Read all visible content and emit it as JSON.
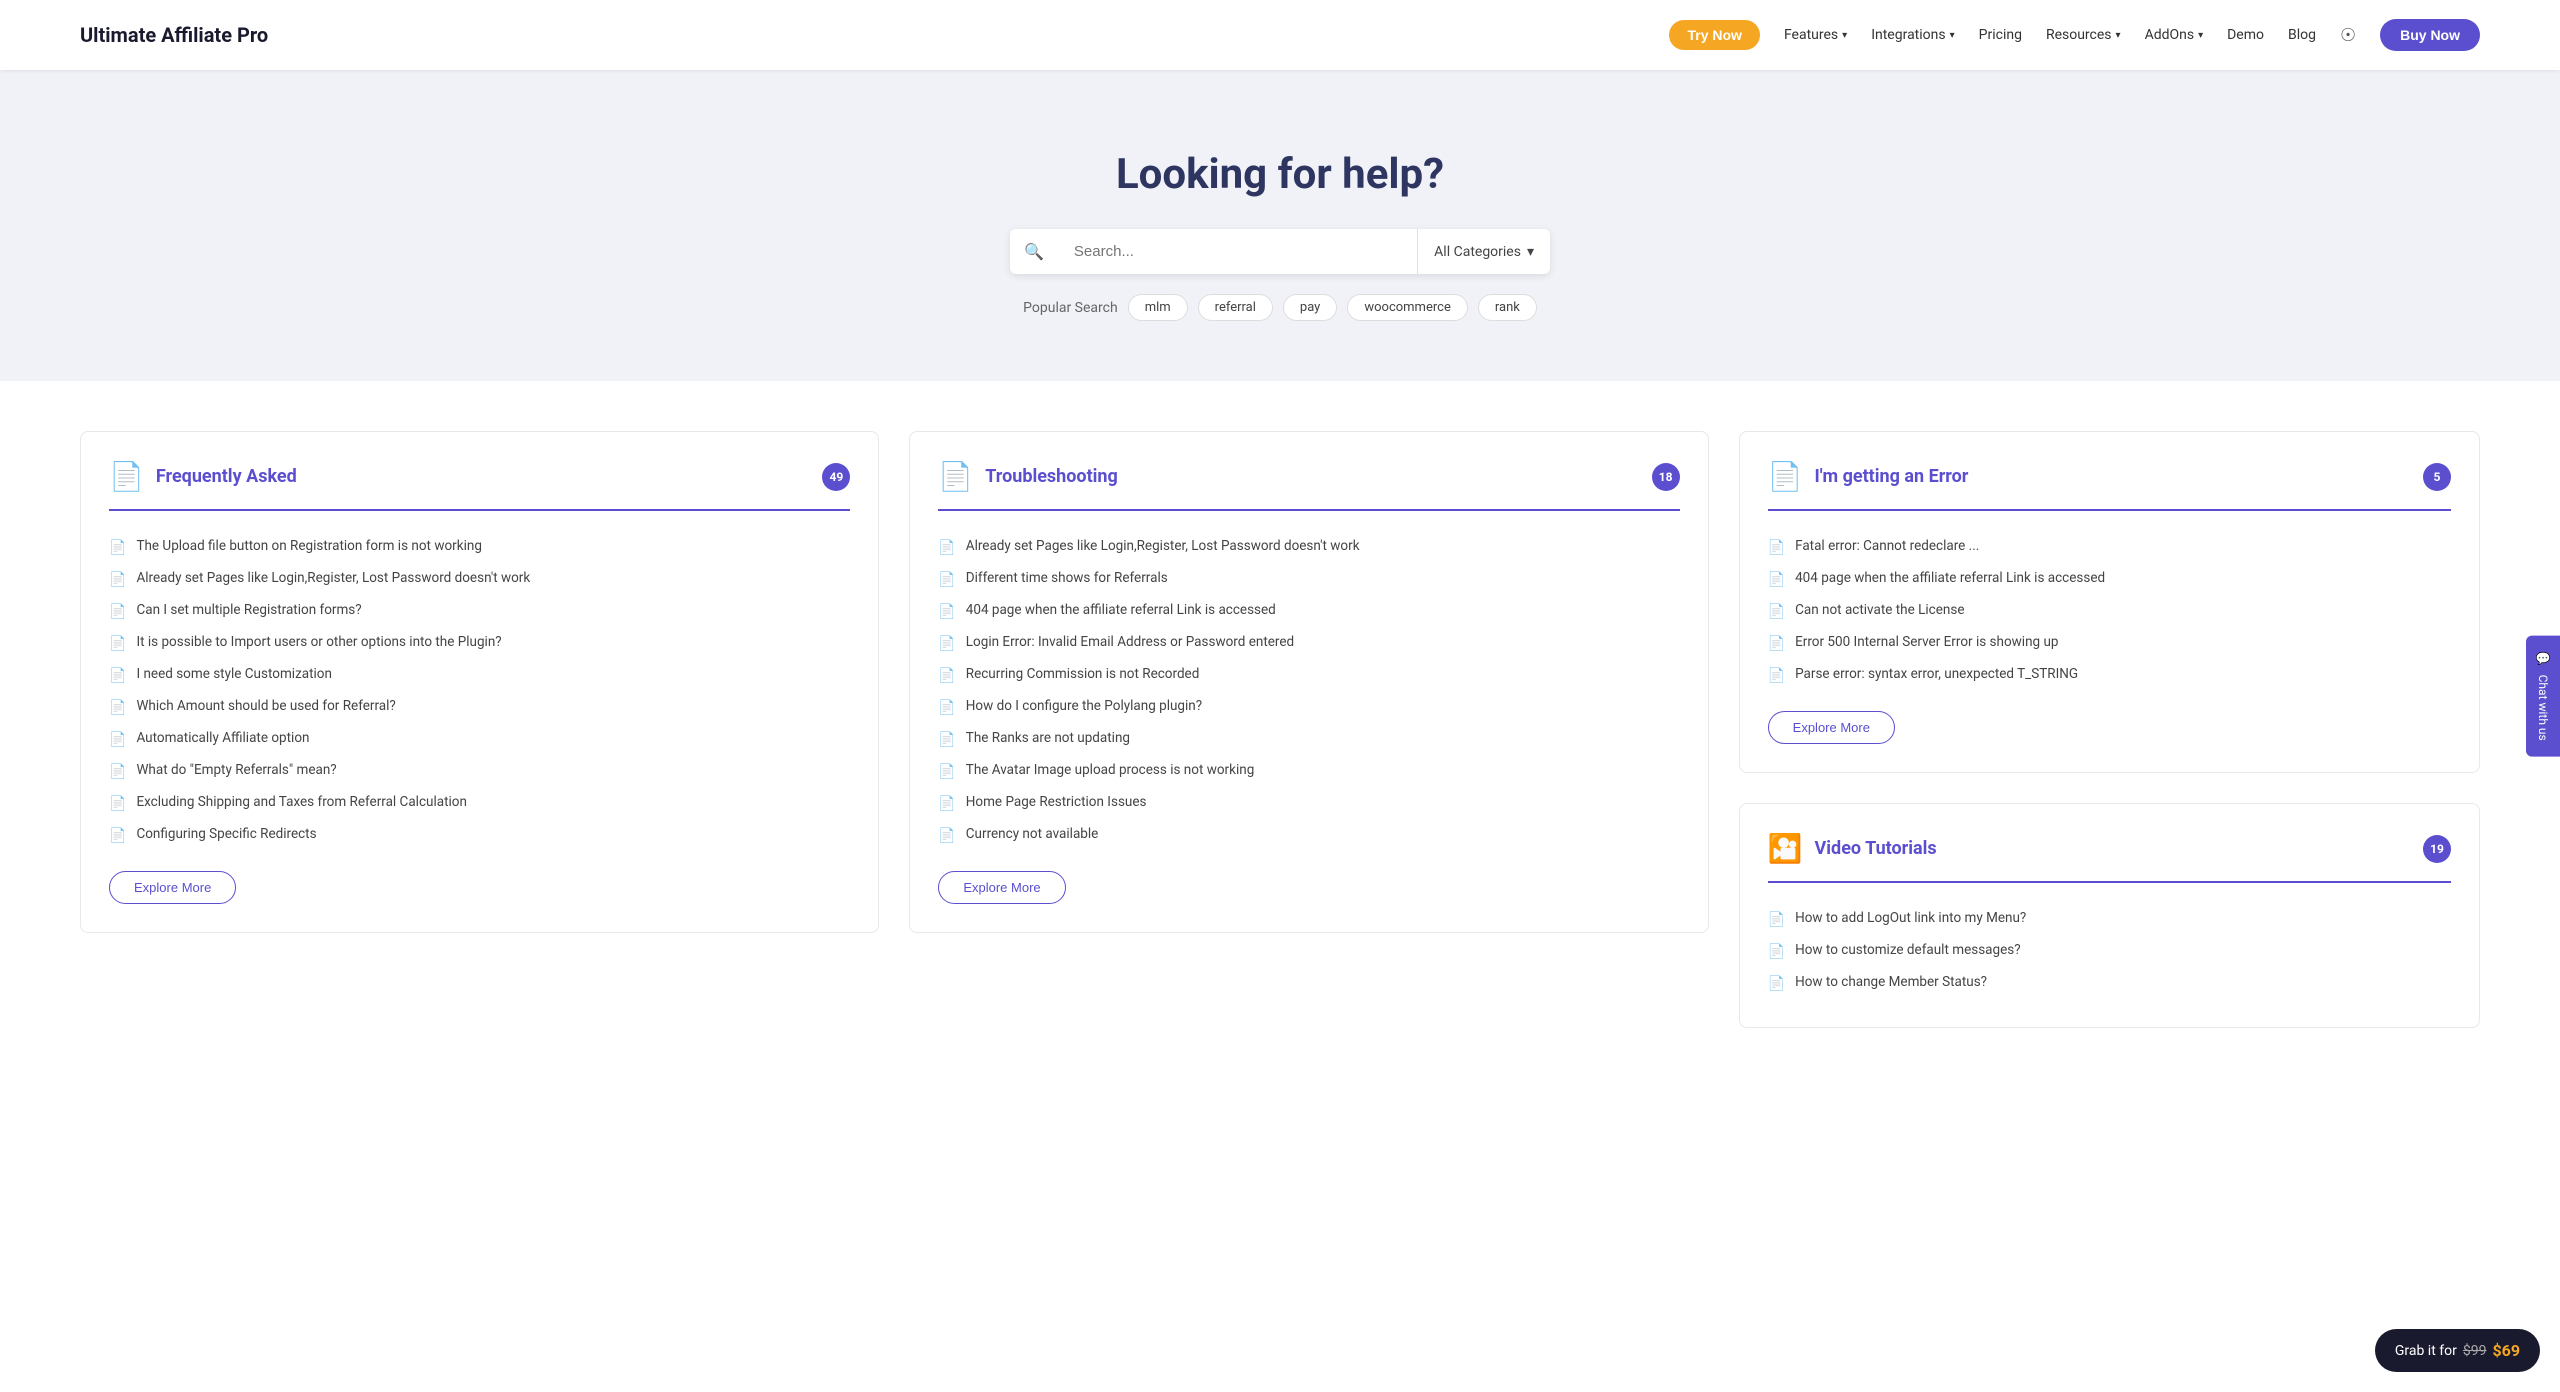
{
  "brand": "Ultimate Affiliate Pro",
  "nav": {
    "try_now": "Try Now",
    "links": [
      {
        "label": "Features",
        "has_dropdown": true
      },
      {
        "label": "Integrations",
        "has_dropdown": true
      },
      {
        "label": "Pricing",
        "has_dropdown": false
      },
      {
        "label": "Resources",
        "has_dropdown": true
      },
      {
        "label": "AddOns",
        "has_dropdown": true
      },
      {
        "label": "Demo",
        "has_dropdown": false
      },
      {
        "label": "Blog",
        "has_dropdown": false
      }
    ],
    "buy_now": "Buy Now"
  },
  "hero": {
    "title": "Looking for help?",
    "search_placeholder": "Search...",
    "category_label": "All Categories",
    "popular_label": "Popular Search",
    "tags": [
      "mlm",
      "referral",
      "pay",
      "woocommerce",
      "rank"
    ]
  },
  "sections": {
    "frequently_asked": {
      "title": "Frequently Asked",
      "badge": "49",
      "items": [
        "The Upload file button on Registration form is not working",
        "Already set Pages like Login,Register, Lost Password doesn't work",
        "Can I set multiple Registration forms?",
        "It is possible to Import users or other options into the Plugin?",
        "I need some style Customization",
        "Which Amount should be used for Referral?",
        "Automatically Affiliate option",
        "What do \"Empty Referrals\" mean?",
        "Excluding Shipping and Taxes from Referral Calculation",
        "Configuring Specific Redirects"
      ],
      "explore_btn": "Explore More"
    },
    "troubleshooting": {
      "title": "Troubleshooting",
      "badge": "18",
      "items": [
        "Already set Pages like Login,Register, Lost Password doesn't work",
        "Different time shows for Referrals",
        "404 page when the affiliate referral Link is accessed",
        "Login Error: Invalid Email Address or Password entered",
        "Recurring Commission is not Recorded",
        "How do I configure the Polylang plugin?",
        "The Ranks are not updating",
        "The Avatar Image upload process is not working",
        "Home Page Restriction Issues",
        "Currency not available"
      ],
      "explore_btn": "Explore More"
    },
    "error": {
      "title": "I'm getting an Error",
      "badge": "5",
      "items": [
        "Fatal error: Cannot redeclare ...",
        "404 page when the affiliate referral Link is accessed",
        "Can not activate the License",
        "Error 500 Internal Server Error is showing up",
        "Parse error: syntax error, unexpected T_STRING"
      ],
      "explore_btn": "Explore More"
    },
    "video_tutorials": {
      "title": "Video Tutorials",
      "badge": "19",
      "items": [
        "How to add LogOut link into my Menu?",
        "How to customize default messages?",
        "How to change Member Status?"
      ]
    }
  },
  "chat_sidebar": "Chat with us",
  "buy_bar": {
    "prefix": "Grab it for",
    "old_price": "$99",
    "new_price": "$69"
  }
}
